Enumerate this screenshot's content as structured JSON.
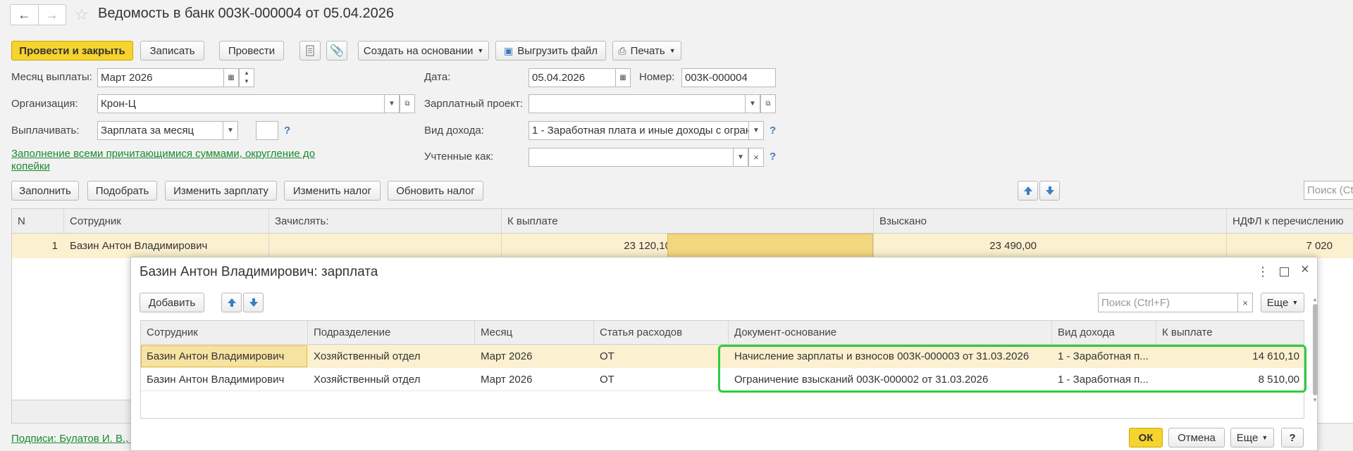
{
  "window": {
    "title": "Ведомость в банк 003К-000004 от 05.04.2026"
  },
  "toolbar": {
    "post_close": "Провести и закрыть",
    "save": "Записать",
    "post": "Провести",
    "create_based": "Создать на основании",
    "export_file": "Выгрузить файл",
    "print": "Печать"
  },
  "form": {
    "month_label": "Месяц выплаты:",
    "month_value": "Март 2026",
    "date_label": "Дата:",
    "date_value": "05.04.2026",
    "number_label": "Номер:",
    "number_value": "003К-000004",
    "org_label": "Организация:",
    "org_value": "Крон-Ц",
    "project_label": "Зарплатный проект:",
    "project_value": "",
    "pay_label": "Выплачивать:",
    "pay_value": "Зарплата за месяц",
    "income_label": "Вид дохода:",
    "income_value": "1 - Заработная плата и иные доходы с огран",
    "accounted_label": "Учтенные как:",
    "accounted_value": "",
    "fill_link": "Заполнение всеми причитающимися суммами, округление до копейки",
    "help": "?"
  },
  "actions": {
    "fill": "Заполнить",
    "select": "Подобрать",
    "change_salary": "Изменить зарплату",
    "change_tax": "Изменить налог",
    "update_tax": "Обновить налог",
    "search_placeholder": "Поиск (Ctrl+F)"
  },
  "main_table": {
    "columns": [
      "N",
      "Сотрудник",
      "Зачислять:",
      "К выплате",
      "Взыскано",
      "НДФЛ к перечислению"
    ],
    "rows": [
      {
        "n": "1",
        "employee": "Базин Антон Владимирович",
        "credit": "",
        "to_pay": "23 120,10",
        "collected": "23 490,00",
        "ndfl": "7 020"
      }
    ]
  },
  "signatures_link": "Подписи: Булатов И. В., ...",
  "dialog": {
    "title": "Базин Антон Владимирович: зарплата",
    "add": "Добавить",
    "search_placeholder": "Поиск (Ctrl+F)",
    "more": "Еще",
    "columns": [
      "Сотрудник",
      "Подразделение",
      "Месяц",
      "Статья расходов",
      "Документ-основание",
      "Вид дохода",
      "К выплате"
    ],
    "rows": [
      {
        "employee": "Базин Антон Владимирович",
        "dept": "Хозяйственный отдел",
        "month": "Март 2026",
        "expense": "ОТ",
        "doc": "Начисление зарплаты и взносов 003К-000003 от 31.03.2026",
        "income": "1 - Заработная п...",
        "amount": "14 610,10"
      },
      {
        "employee": "Базин Антон Владимирович",
        "dept": "Хозяйственный отдел",
        "month": "Март 2026",
        "expense": "ОТ",
        "doc": "Ограничение взысканий 003К-000002 от 31.03.2026",
        "income": "1 - Заработная п...",
        "amount": "8 510,00"
      }
    ],
    "ok": "ОК",
    "cancel": "Отмена",
    "more_bottom": "Еще",
    "help": "?"
  },
  "colors": {
    "accent_yellow": "#f6d32d",
    "row_highlight": "#fbf0cf",
    "link_green": "#1a8a2e",
    "callout_green": "#2ecc40",
    "arrow_blue": "#3a7ebf"
  }
}
